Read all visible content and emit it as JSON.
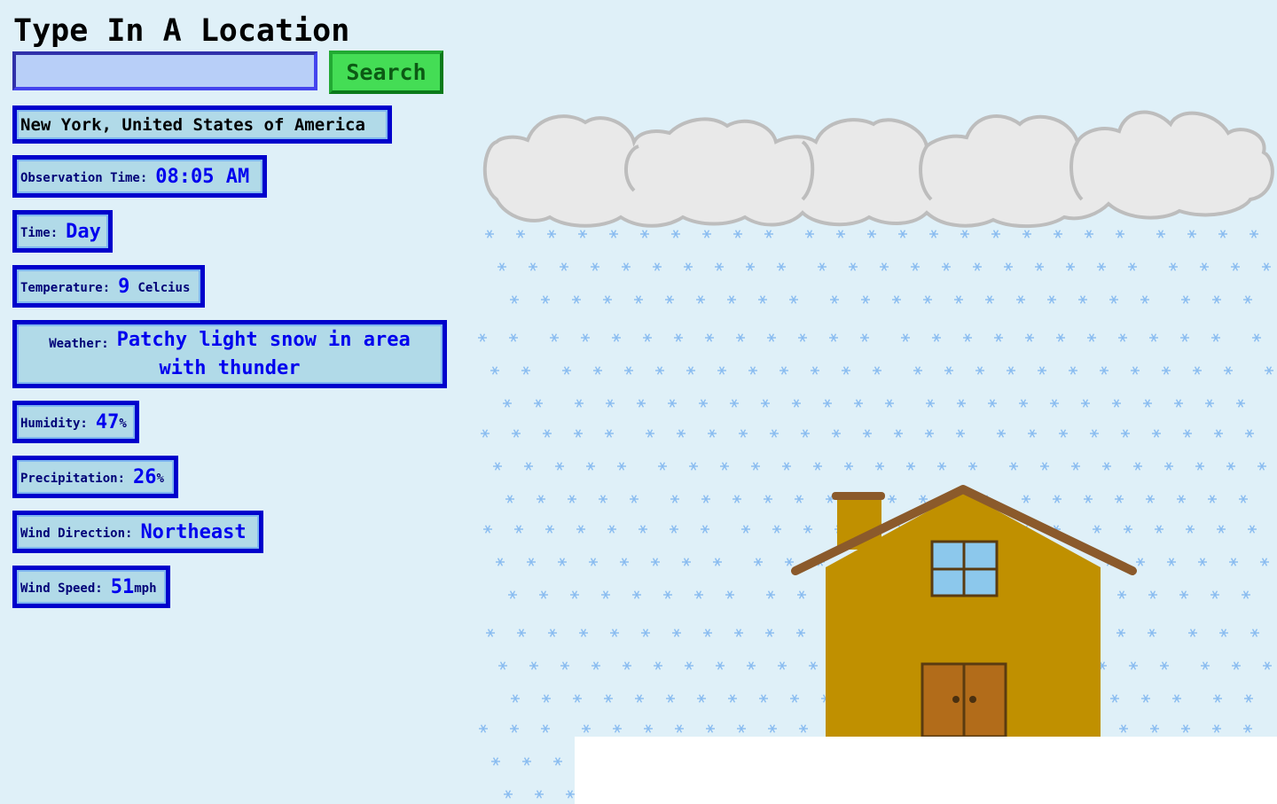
{
  "header": {
    "title": "Type In A Location"
  },
  "search": {
    "value": "",
    "placeholder": "",
    "button_label": "Search"
  },
  "location": {
    "name": "New York, United States of America"
  },
  "observation_time": {
    "label": "Observation Time:",
    "value": "08:05 AM"
  },
  "time_of_day": {
    "label": "Time:",
    "value": "Day"
  },
  "temperature": {
    "label": "Temperature:",
    "value": "9",
    "unit": "Celcius"
  },
  "weather": {
    "label": "Weather:",
    "value": "Patchy light snow in area with thunder"
  },
  "humidity": {
    "label": "Humidity:",
    "value": "47",
    "unit": "%"
  },
  "precipitation": {
    "label": "Precipitation:",
    "value": "26",
    "unit": "%"
  },
  "wind_direction": {
    "label": "Wind Direction:",
    "value": "Northeast"
  },
  "wind_speed": {
    "label": "Wind Speed:",
    "value": "51",
    "unit": "mph"
  },
  "scene": {
    "icons": [
      "cloud-icon",
      "snowflake-icon",
      "house-icon"
    ]
  },
  "colors": {
    "background": "#dff0f8",
    "card_bg": "#b1dae8",
    "card_border": "#0000cc",
    "value_text": "#0000ee",
    "search_button": "#44dd55",
    "house": "#c09000",
    "roof": "#8b5a2b",
    "snow": "#88bbf0"
  }
}
